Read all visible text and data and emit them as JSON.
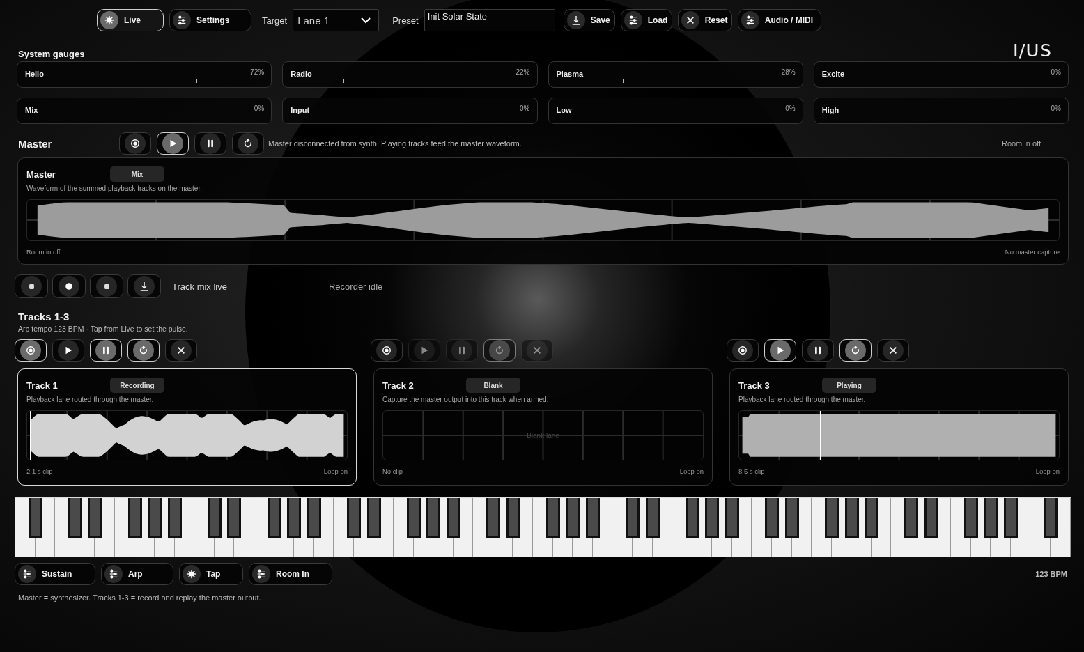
{
  "toolbar": {
    "mode_buttons": [
      {
        "label": "Live",
        "selected": true
      },
      {
        "label": "Settings",
        "selected": false
      }
    ],
    "target": {
      "label": "Target",
      "value": "Lane 1"
    },
    "preset": {
      "label": "Preset",
      "value": "Init Solar State"
    },
    "items": [
      {
        "kind": "button",
        "label": "Save",
        "selected": false
      },
      {
        "kind": "button",
        "label": "Load",
        "selected": false
      },
      {
        "kind": "button",
        "label": "Reset",
        "selected": false
      },
      {
        "kind": "button",
        "label": "Audio / MIDI",
        "selected": false
      }
    ]
  },
  "logo": "I/US",
  "gauges": {
    "title": "System gauges",
    "items": [
      {
        "name": "Helio",
        "reading": "72%",
        "level": 0.72
      },
      {
        "name": "Radio",
        "reading": "22%",
        "level": 0.22
      },
      {
        "name": "Plasma",
        "reading": "28%",
        "level": 0.28
      },
      {
        "name": "Excite",
        "reading": "0%"
      },
      {
        "name": "Mix",
        "reading": "0%"
      },
      {
        "name": "Input",
        "reading": "0%"
      },
      {
        "name": "Low",
        "reading": "0%"
      },
      {
        "name": "High",
        "reading": "0%"
      }
    ]
  },
  "master": {
    "title": "Master",
    "transport": [
      {
        "kind": "record",
        "active": false,
        "disabled": false
      },
      {
        "kind": "play",
        "active": true,
        "disabled": false
      },
      {
        "kind": "pause",
        "active": false,
        "disabled": false
      },
      {
        "kind": "loop",
        "active": false,
        "disabled": false
      }
    ],
    "message": "Master disconnected from synth. Playing tracks feed the master waveform.",
    "room_status": "Room in off",
    "card": {
      "title": "Master",
      "badge": "Mix",
      "description": "Waveform of the summed playback tracks on the master.",
      "waveform": {
        "kind": "swell"
      },
      "footer_left": "Room in off",
      "footer_right": "No master capture"
    }
  },
  "recorder": {
    "buttons": [
      {
        "kind": "stop"
      },
      {
        "kind": "record"
      },
      {
        "kind": "stop"
      },
      {
        "kind": "download"
      }
    ],
    "mix_status": "Track mix live",
    "recorder_status": "Recorder idle"
  },
  "tracks": {
    "title": "Tracks 1-3",
    "subtitle": "Arp tempo 123 BPM · Tap from Live to set the pulse.",
    "items": [
      {
        "transport": [
          {
            "kind": "record",
            "active": true,
            "disabled": false
          },
          {
            "kind": "play",
            "active": false,
            "disabled": false
          },
          {
            "kind": "pause",
            "active": true,
            "disabled": false
          },
          {
            "kind": "loop",
            "active": true,
            "disabled": false
          },
          {
            "kind": "clear",
            "active": false,
            "disabled": false
          }
        ],
        "title": "Track 1",
        "badge": "Recording",
        "selected": true,
        "description": "Playback lane routed through the master.",
        "waveform": {
          "kind": "burst",
          "playhead": {
            "level": 0
          }
        },
        "footer_left": "2.1 s clip",
        "footer_right": "Loop on"
      },
      {
        "transport": [
          {
            "kind": "record",
            "active": false,
            "disabled": false
          },
          {
            "kind": "play",
            "active": false,
            "disabled": true
          },
          {
            "kind": "pause",
            "active": false,
            "disabled": true
          },
          {
            "kind": "loop",
            "active": true,
            "disabled": true
          },
          {
            "kind": "clear",
            "active": false,
            "disabled": true
          }
        ],
        "title": "Track 2",
        "badge": "Blank",
        "selected": false,
        "description": "Capture the master output into this track when armed.",
        "waveform": {
          "kind": "blank",
          "label": "Blank lane"
        },
        "footer_left": "No clip",
        "footer_right": "Loop on"
      },
      {
        "transport": [
          {
            "kind": "record",
            "active": false,
            "disabled": false
          },
          {
            "kind": "play",
            "active": true,
            "disabled": false
          },
          {
            "kind": "pause",
            "active": false,
            "disabled": false
          },
          {
            "kind": "loop",
            "active": true,
            "disabled": false
          },
          {
            "kind": "clear",
            "active": false,
            "disabled": false
          }
        ],
        "title": "Track 3",
        "badge": "Playing",
        "selected": false,
        "description": "Playback lane routed through the master.",
        "waveform": {
          "kind": "dense",
          "playhead": {
            "level": 0.25
          }
        },
        "footer_left": "8.5 s clip",
        "footer_right": "Loop on"
      }
    ]
  },
  "controls": {
    "buttons": [
      {
        "label": "Sustain"
      },
      {
        "label": "Arp"
      },
      {
        "label": "Tap"
      },
      {
        "label": "Room In"
      }
    ],
    "bpm": "123 BPM"
  },
  "footnote": "Master = synthesizer. Tracks 1-3 = record and replay the master output."
}
